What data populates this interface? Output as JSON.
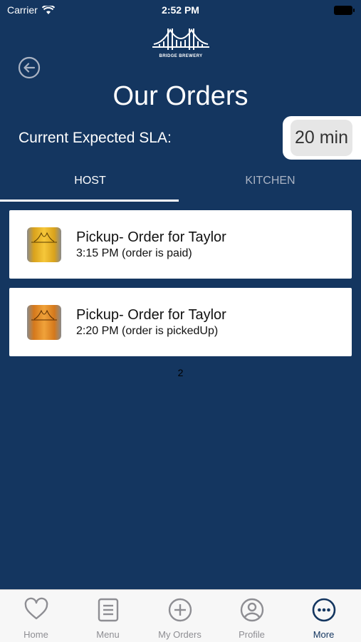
{
  "status_bar": {
    "carrier": "Carrier",
    "time": "2:52 PM"
  },
  "brand": {
    "logo_text": "BRIDGE BREWERY"
  },
  "header": {
    "title": "Our Orders"
  },
  "sla": {
    "label": "Current Expected SLA:",
    "value": "20 min"
  },
  "tabs": [
    {
      "label": "HOST",
      "active": true
    },
    {
      "label": "KITCHEN",
      "active": false
    }
  ],
  "orders": [
    {
      "title": "Pickup- Order for Taylor",
      "status": "3:15 PM (order is paid)"
    },
    {
      "title": "Pickup- Order for Taylor",
      "status": "2:20 PM (order is pickedUp)"
    }
  ],
  "order_count": "2",
  "bottom_nav": [
    {
      "label": "Home",
      "icon": "heart-icon"
    },
    {
      "label": "Menu",
      "icon": "menu-list-icon"
    },
    {
      "label": "My Orders",
      "icon": "plus-circle-icon"
    },
    {
      "label": "Profile",
      "icon": "user-circle-icon"
    },
    {
      "label": "More",
      "icon": "more-circle-icon",
      "active": true
    }
  ],
  "colors": {
    "background": "#143660",
    "card": "#ffffff",
    "active_nav": "#143660",
    "inactive_nav": "#8e8e93"
  }
}
